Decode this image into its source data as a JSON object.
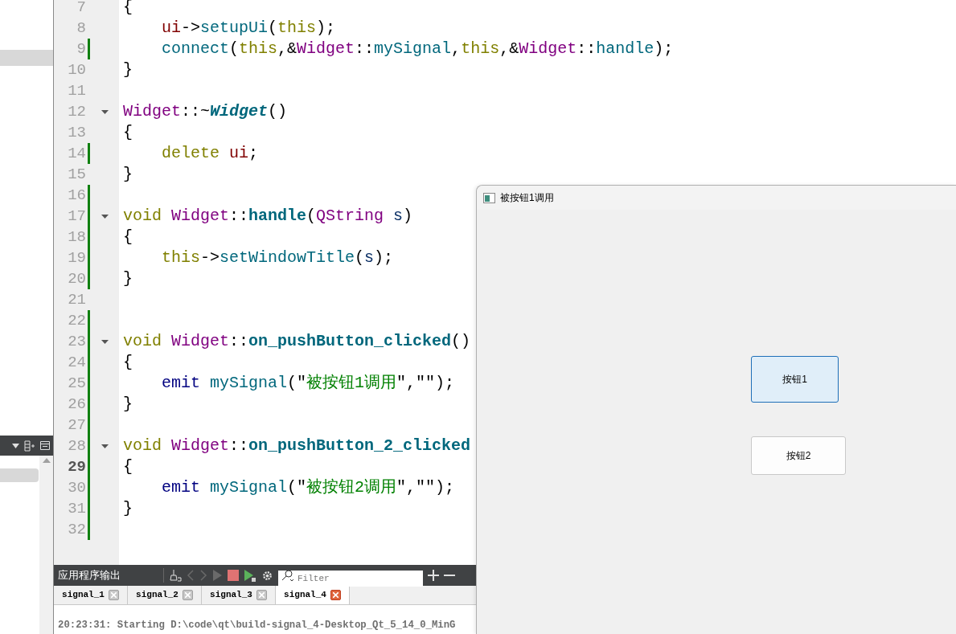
{
  "editor": {
    "lines": [
      {
        "number": "7",
        "current": false,
        "changed": false,
        "foldable": false,
        "indented": false,
        "tokens": [
          {
            "kind": "plain",
            "text": "{"
          }
        ]
      },
      {
        "number": "8",
        "current": false,
        "changed": false,
        "foldable": false,
        "indented": true,
        "tokens": [
          {
            "kind": "member",
            "text": "ui"
          },
          {
            "kind": "plain",
            "text": "->"
          },
          {
            "kind": "call",
            "text": "setupUi"
          },
          {
            "kind": "plain",
            "text": "("
          },
          {
            "kind": "keyword",
            "text": "this"
          },
          {
            "kind": "plain",
            "text": ");"
          }
        ]
      },
      {
        "number": "9",
        "current": false,
        "changed": true,
        "foldable": false,
        "indented": true,
        "tokens": [
          {
            "kind": "call",
            "text": "connect"
          },
          {
            "kind": "plain",
            "text": "("
          },
          {
            "kind": "keyword",
            "text": "this"
          },
          {
            "kind": "plain",
            "text": ",&"
          },
          {
            "kind": "type",
            "text": "Widget"
          },
          {
            "kind": "plain",
            "text": "::"
          },
          {
            "kind": "call",
            "text": "mySignal"
          },
          {
            "kind": "plain",
            "text": ","
          },
          {
            "kind": "keyword",
            "text": "this"
          },
          {
            "kind": "plain",
            "text": ",&"
          },
          {
            "kind": "type",
            "text": "Widget"
          },
          {
            "kind": "plain",
            "text": "::"
          },
          {
            "kind": "call",
            "text": "handle"
          },
          {
            "kind": "plain",
            "text": ");"
          }
        ]
      },
      {
        "number": "10",
        "current": false,
        "changed": false,
        "foldable": false,
        "indented": false,
        "tokens": [
          {
            "kind": "plain",
            "text": "}"
          }
        ]
      },
      {
        "number": "11",
        "current": false,
        "changed": false,
        "foldable": false
      },
      {
        "number": "12",
        "current": false,
        "changed": false,
        "foldable": true,
        "indented": false,
        "tokens": [
          {
            "kind": "type",
            "text": "Widget"
          },
          {
            "kind": "plain",
            "text": "::~"
          },
          {
            "kind": "destructor",
            "text": "Widget"
          },
          {
            "kind": "plain",
            "text": "()"
          }
        ]
      },
      {
        "number": "13",
        "current": false,
        "changed": false,
        "foldable": false,
        "indented": false,
        "tokens": [
          {
            "kind": "plain",
            "text": "{"
          }
        ]
      },
      {
        "number": "14",
        "current": false,
        "changed": true,
        "foldable": false,
        "indented": true,
        "tokens": [
          {
            "kind": "keyword",
            "text": "delete "
          },
          {
            "kind": "member",
            "text": "ui"
          },
          {
            "kind": "plain",
            "text": ";"
          }
        ]
      },
      {
        "number": "15",
        "current": false,
        "changed": false,
        "foldable": false,
        "indented": false,
        "tokens": [
          {
            "kind": "plain",
            "text": "}"
          }
        ]
      },
      {
        "number": "16",
        "current": false,
        "changed": true,
        "foldable": false
      },
      {
        "number": "17",
        "current": false,
        "changed": true,
        "foldable": true,
        "indented": false,
        "tokens": [
          {
            "kind": "keyword",
            "text": "void "
          },
          {
            "kind": "type",
            "text": "Widget"
          },
          {
            "kind": "plain",
            "text": "::"
          },
          {
            "kind": "definition",
            "text": "handle"
          },
          {
            "kind": "plain",
            "text": "("
          },
          {
            "kind": "type",
            "text": "QString "
          },
          {
            "kind": "variable",
            "text": "s"
          },
          {
            "kind": "plain",
            "text": ")"
          }
        ]
      },
      {
        "number": "18",
        "current": false,
        "changed": true,
        "foldable": false,
        "indented": false,
        "tokens": [
          {
            "kind": "plain",
            "text": "{"
          }
        ]
      },
      {
        "number": "19",
        "current": false,
        "changed": true,
        "foldable": false,
        "indented": true,
        "tokens": [
          {
            "kind": "keyword",
            "text": "this"
          },
          {
            "kind": "plain",
            "text": "->"
          },
          {
            "kind": "call",
            "text": "setWindowTitle"
          },
          {
            "kind": "plain",
            "text": "("
          },
          {
            "kind": "variable",
            "text": "s"
          },
          {
            "kind": "plain",
            "text": ");"
          }
        ]
      },
      {
        "number": "20",
        "current": false,
        "changed": true,
        "foldable": false,
        "indented": false,
        "tokens": [
          {
            "kind": "plain",
            "text": "}"
          }
        ]
      },
      {
        "number": "21",
        "current": false,
        "changed": false,
        "foldable": false
      },
      {
        "number": "22",
        "current": false,
        "changed": true,
        "foldable": false
      },
      {
        "number": "23",
        "current": false,
        "changed": true,
        "foldable": true,
        "indented": false,
        "tokens": [
          {
            "kind": "keyword",
            "text": "void "
          },
          {
            "kind": "type",
            "text": "Widget"
          },
          {
            "kind": "plain",
            "text": "::"
          },
          {
            "kind": "definition",
            "text": "on_pushButton_clicked"
          },
          {
            "kind": "plain",
            "text": "()"
          }
        ]
      },
      {
        "number": "24",
        "current": false,
        "changed": true,
        "foldable": false,
        "indented": false,
        "tokens": [
          {
            "kind": "plain",
            "text": "{"
          }
        ]
      },
      {
        "number": "25",
        "current": false,
        "changed": true,
        "foldable": false,
        "indented": true,
        "tokens": [
          {
            "kind": "emit",
            "text": "emit "
          },
          {
            "kind": "call",
            "text": "mySignal"
          },
          {
            "kind": "plain",
            "text": "(\""
          },
          {
            "kind": "string",
            "text": "被按钮1调用"
          },
          {
            "kind": "plain",
            "text": "\",\"\");"
          }
        ]
      },
      {
        "number": "26",
        "current": false,
        "changed": true,
        "foldable": false,
        "indented": false,
        "tokens": [
          {
            "kind": "plain",
            "text": "}"
          }
        ]
      },
      {
        "number": "27",
        "current": false,
        "changed": true,
        "foldable": false
      },
      {
        "number": "28",
        "current": false,
        "changed": true,
        "foldable": true,
        "indented": false,
        "tokens": [
          {
            "kind": "keyword",
            "text": "void "
          },
          {
            "kind": "type",
            "text": "Widget"
          },
          {
            "kind": "plain",
            "text": "::"
          },
          {
            "kind": "definition",
            "text": "on_pushButton_2_clicked"
          }
        ]
      },
      {
        "number": "29",
        "current": true,
        "changed": true,
        "foldable": false,
        "indented": false,
        "tokens": [
          {
            "kind": "plain",
            "text": "{"
          }
        ]
      },
      {
        "number": "30",
        "current": false,
        "changed": true,
        "foldable": false,
        "indented": true,
        "tokens": [
          {
            "kind": "emit",
            "text": "emit "
          },
          {
            "kind": "call",
            "text": "mySignal"
          },
          {
            "kind": "plain",
            "text": "(\""
          },
          {
            "kind": "string",
            "text": "被按钮2调用"
          },
          {
            "kind": "plain",
            "text": "\",\"\");"
          }
        ]
      },
      {
        "number": "31",
        "current": false,
        "changed": true,
        "foldable": false,
        "indented": false,
        "tokens": [
          {
            "kind": "plain",
            "text": "}"
          }
        ]
      },
      {
        "number": "32",
        "current": false,
        "changed": true,
        "foldable": false
      }
    ]
  },
  "output_pane": {
    "title": "应用程序输出",
    "filter": {
      "placeholder": "Filter"
    },
    "tabs": [
      {
        "label": "signal_1",
        "selected": false
      },
      {
        "label": "signal_2",
        "selected": false
      },
      {
        "label": "signal_3",
        "selected": false
      },
      {
        "label": "signal_4",
        "selected": true
      }
    ],
    "log": [
      "20:23:31: Starting D:\\code\\qt\\build-signal_4-Desktop_Qt_5_14_0_MinG"
    ]
  },
  "dialog": {
    "title": "被按钮1调用",
    "buttons": [
      {
        "label": "按钮1",
        "focused": true
      },
      {
        "label": "按钮2",
        "focused": false
      }
    ]
  }
}
